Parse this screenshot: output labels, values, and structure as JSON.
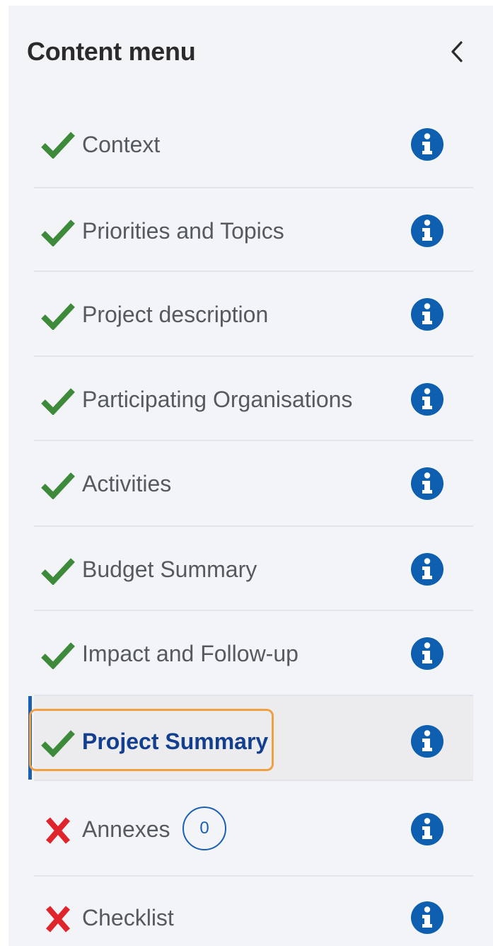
{
  "header": {
    "title": "Content menu",
    "collapse_icon": "chevron-left-icon"
  },
  "colors": {
    "check": "#3c8a3a",
    "cross": "#e0242c",
    "info": "#0e5fb0",
    "active_text": "#143f8f",
    "highlight_outline": "#f0a040"
  },
  "menu": {
    "items": [
      {
        "label": "Context",
        "status": "complete"
      },
      {
        "label": "Priorities and Topics",
        "status": "complete"
      },
      {
        "label": "Project description",
        "status": "complete"
      },
      {
        "label": "Participating Organisations",
        "status": "complete"
      },
      {
        "label": "Activities",
        "status": "complete"
      },
      {
        "label": "Budget Summary",
        "status": "complete"
      },
      {
        "label": "Impact and Follow-up",
        "status": "complete"
      },
      {
        "label": "Project Summary",
        "status": "complete",
        "active": true
      },
      {
        "label": "Annexes",
        "status": "incomplete",
        "count": "0"
      },
      {
        "label": "Checklist",
        "status": "incomplete"
      }
    ]
  }
}
